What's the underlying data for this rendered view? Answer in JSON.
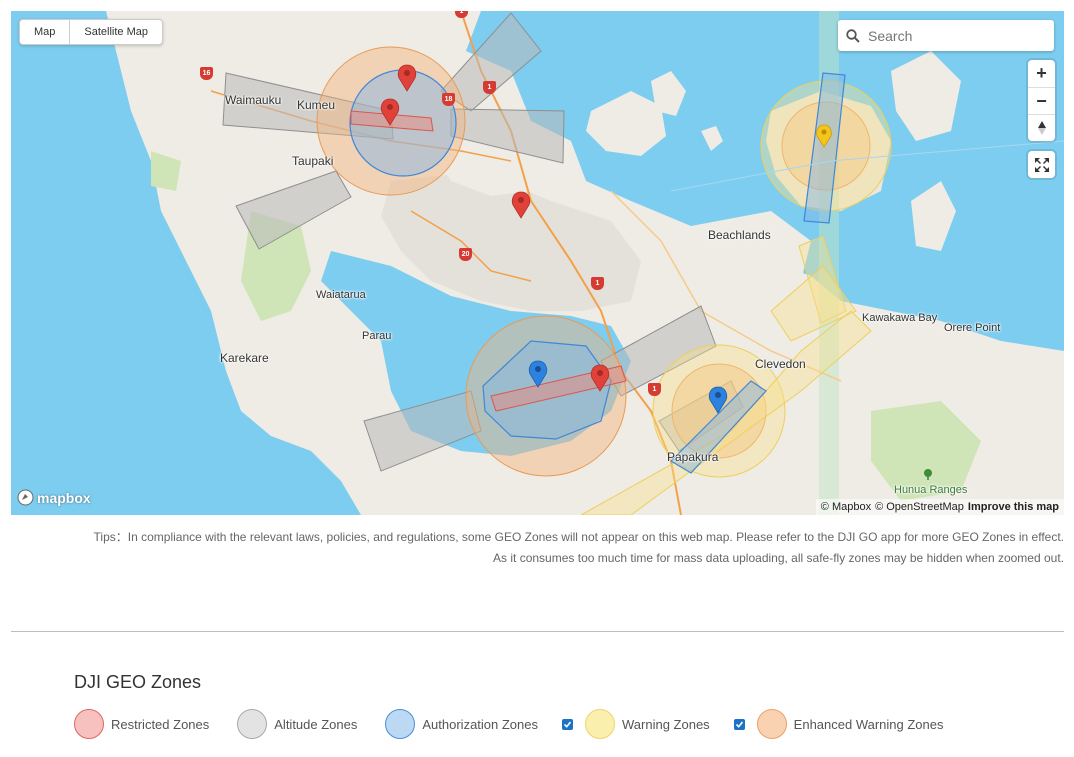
{
  "map": {
    "map_types": [
      "Map",
      "Satellite Map"
    ],
    "search_placeholder": "Search",
    "zoom_in": "+",
    "zoom_out": "−",
    "compass": "▲",
    "logo_text": "mapbox",
    "attribution": [
      "© Mapbox",
      "© OpenStreetMap",
      "Improve this map"
    ],
    "place_labels": [
      "Waimauku",
      "Kumeu",
      "Taupaki",
      "Beachlands",
      "Waiatarua",
      "Parau",
      "Karekare",
      "Kawakawa Bay",
      "Orere Point",
      "Clevedon",
      "Papakura",
      "Hunua Ranges"
    ],
    "road_shields": [
      "16",
      "16",
      "1",
      "18",
      "1",
      "20",
      "1",
      "1"
    ],
    "colors": {
      "water": "#7dcdf0",
      "land": "#eeece4",
      "park": "#cfe5b8",
      "urban": "#e3e1d9",
      "restricted": "#e0423a",
      "altitude": "#9a9a9a",
      "authorization": "#3f87d9",
      "warning": "#f6d85b",
      "enhanced_warning": "#f2a05a"
    }
  },
  "tips": {
    "line1": "Tips：In compliance with the relevant laws, policies, and regulations, some GEO Zones will not appear on this web map. Please refer to the DJI GO app for more GEO Zones in effect.",
    "line2": "As it consumes too much time for mass data uploading, all safe-fly zones may be hidden when zoomed out."
  },
  "legend": {
    "title": "DJI GEO Zones",
    "items": [
      {
        "label": "Restricted Zones",
        "fill": "#f6c1bf",
        "stroke": "#e0665f",
        "checkbox": false
      },
      {
        "label": "Altitude Zones",
        "fill": "#e3e3e3",
        "stroke": "#a8a8a8",
        "checkbox": false
      },
      {
        "label": "Authorization Zones",
        "fill": "#bcd9f3",
        "stroke": "#4a8ed8",
        "checkbox": false
      },
      {
        "label": "Warning Zones",
        "fill": "#fbefae",
        "stroke": "#ecd46a",
        "checkbox": true
      },
      {
        "label": "Enhanced Warning Zones",
        "fill": "#f8d2b1",
        "stroke": "#eba06a",
        "checkbox": true
      }
    ]
  }
}
